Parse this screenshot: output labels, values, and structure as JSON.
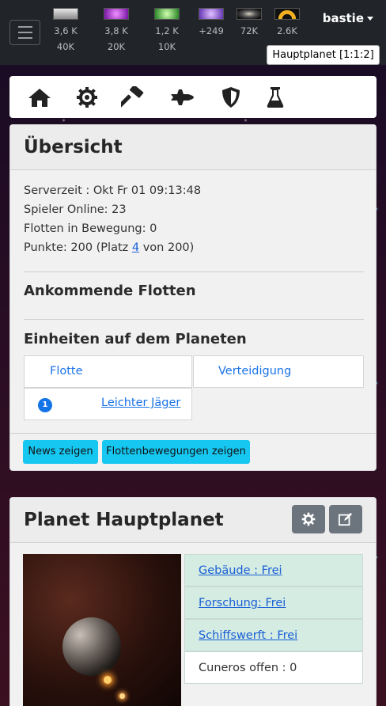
{
  "navbar": {
    "user_name": "bastie",
    "planet_selector": "Hauptplanet [1:1:2]",
    "resources": [
      {
        "name": "metal-icon",
        "top": "3,6 K",
        "bottom": "40K",
        "color": "#b0b0b0"
      },
      {
        "name": "crystal-icon",
        "top": "3,8 K",
        "bottom": "20K",
        "color": "#b040d0"
      },
      {
        "name": "deuterium-icon",
        "top": "1,2 K",
        "bottom": "10K",
        "color": "#40c040"
      },
      {
        "name": "energy-icon",
        "top": "+249",
        "bottom": "",
        "color": "#9a6ae0"
      },
      {
        "name": "darkmatter-icon",
        "top": "72K",
        "bottom": "",
        "color": "#666666"
      },
      {
        "name": "antimatter-icon",
        "top": "2.6K",
        "bottom": "",
        "color": "#f0b020"
      }
    ]
  },
  "overview": {
    "title": "Übersicht",
    "server_time": "Serverzeit : Okt Fr 01 09:13:48",
    "players_online": "Spieler Online: 23",
    "fleets_moving": "Flotten in Bewegung: 0",
    "points_prefix": "Punkte: 200 (Platz ",
    "points_rank": "4",
    "points_suffix": " von 200)",
    "incoming_title": "Ankommende Flotten",
    "units_title": "Einheiten auf dem Planeten",
    "tab_fleet": "Flotte",
    "tab_defense": "Verteidigung",
    "unit_count": "1",
    "unit_name": "Leichter Jäger",
    "btn_news": "News zeigen",
    "btn_fleet_moves": "Flottenbewegungen zeigen"
  },
  "planet": {
    "title": "Planet Hauptplanet",
    "buildings": "Gebäude : Frei",
    "research": "Forschung: Frei",
    "shipyard": "Schiffswerft : Frei",
    "cuneros": "Cuneros offen : 0"
  },
  "colors": {
    "accent_blue": "#1a5fd6",
    "info_cyan": "#16c7f1",
    "navbar_dark": "#212529"
  }
}
